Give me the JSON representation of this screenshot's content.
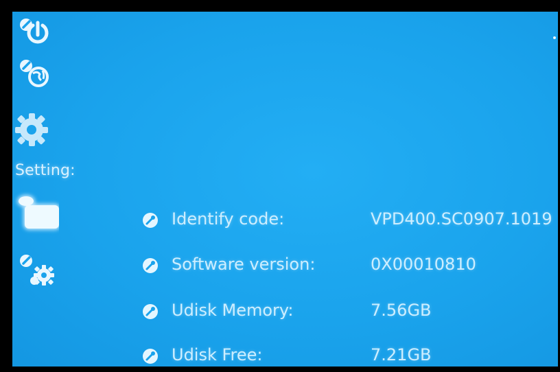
{
  "sidebar": {
    "icons": [
      {
        "name": "power-icon"
      },
      {
        "name": "globe-icon"
      },
      {
        "name": "gear-icon"
      },
      {
        "name": "storage-icon"
      },
      {
        "name": "tools-gear-icon"
      }
    ],
    "setting_label": "Setting:"
  },
  "info": [
    {
      "label": "Identify code:",
      "value": "VPD400.SC0907.1019"
    },
    {
      "label": "Software version:",
      "value": "0X00010810"
    },
    {
      "label": "Udisk Memory:",
      "value": "7.56GB"
    },
    {
      "label": "Udisk Free:",
      "value": "7.21GB"
    }
  ],
  "colors": {
    "background": "#1aa3ec",
    "text": "#cdeeff",
    "bezel": "#000000"
  }
}
